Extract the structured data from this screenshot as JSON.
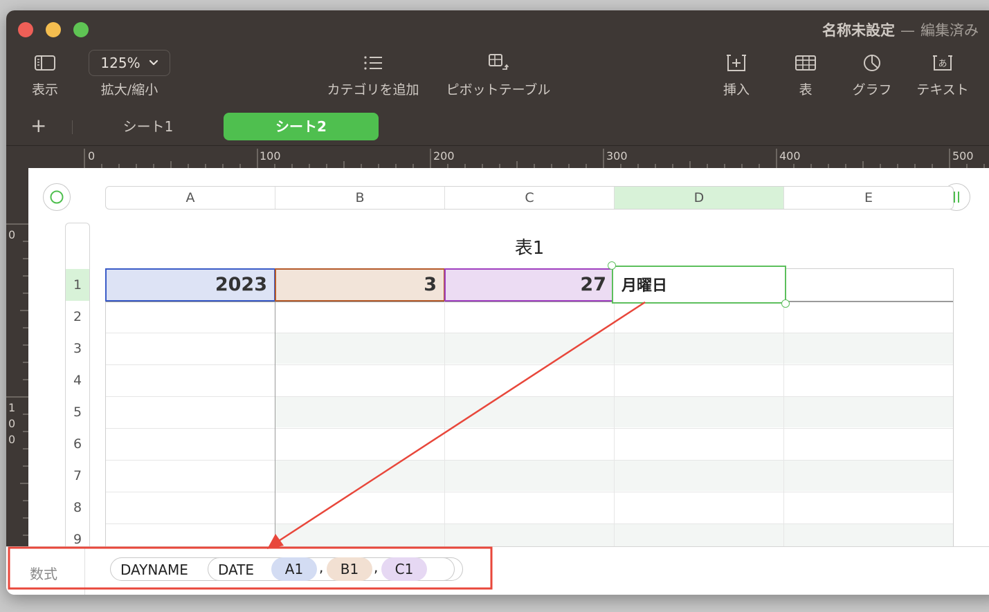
{
  "window": {
    "title": "名称未設定",
    "title_separator": "—",
    "title_status": "編集済み"
  },
  "toolbar": {
    "view_label": "表示",
    "zoom_value": "125%",
    "zoom_label": "拡大/縮小",
    "category_label": "カテゴリを追加",
    "pivot_label": "ピボットテーブル",
    "insert_label": "挿入",
    "table_label": "表",
    "chart_label": "グラフ",
    "text_label": "テキスト"
  },
  "sheets": {
    "add_symbol": "+",
    "tabs": [
      {
        "label": "シート1",
        "active": false
      },
      {
        "label": "シート2",
        "active": true
      }
    ]
  },
  "ruler": {
    "top": [
      "0",
      "100",
      "200",
      "300",
      "400",
      "500"
    ],
    "left": [
      "0",
      "1",
      "0",
      "0"
    ]
  },
  "table": {
    "title": "表1",
    "columns": [
      "A",
      "B",
      "C",
      "D",
      "E"
    ],
    "selected_column": "D",
    "rows": [
      "1",
      "2",
      "3",
      "4",
      "5",
      "6",
      "7",
      "8",
      "9"
    ],
    "selected_row": "1",
    "cells": {
      "A1": "2023",
      "B1": "3",
      "C1": "27",
      "D1": "月曜日"
    }
  },
  "formula": {
    "label": "数式",
    "fn_outer": "DAYNAME",
    "fn_inner": "DATE",
    "arg1": "A1",
    "arg2": "B1",
    "arg3": "C1",
    "comma": ","
  },
  "colors": {
    "toolbar_bg": "#3e3835",
    "active_tab": "#4fbf4f",
    "selection_green": "#5cbf5c",
    "ref_a_fill": "#dde3f5",
    "ref_a_border": "#3a5bc7",
    "ref_b_fill": "#f2e4d9",
    "ref_b_border": "#b55a2a",
    "ref_c_fill": "#ecdcf3",
    "ref_c_border": "#a040c0",
    "annotation_red": "#e8473b"
  }
}
